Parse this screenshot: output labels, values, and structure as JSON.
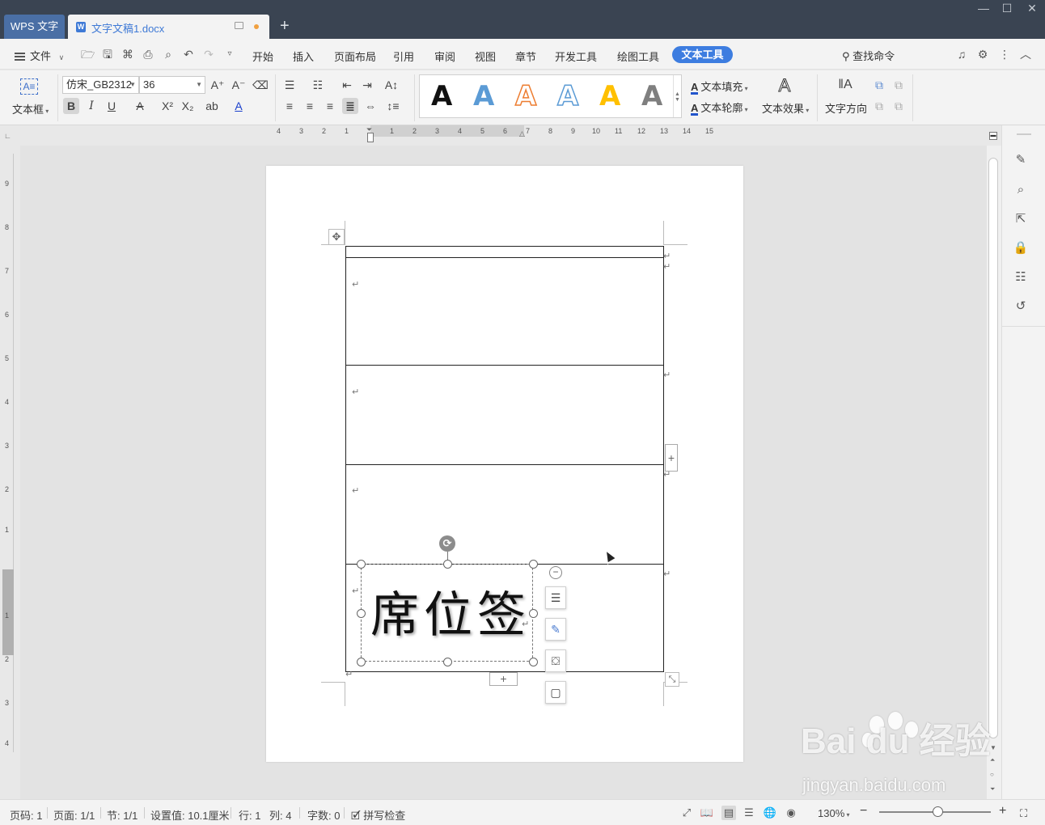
{
  "titlebar": {
    "app_tab": "WPS 文字",
    "doc_tab": "文字文稿1.docx",
    "new_tab": "+"
  },
  "menubar": {
    "file": "文件",
    "items": [
      "开始",
      "插入",
      "页面布局",
      "引用",
      "审阅",
      "视图",
      "章节",
      "开发工具",
      "绘图工具"
    ],
    "active": "文本工具",
    "search": "查找命令"
  },
  "ribbon": {
    "textbox_label": "文本框",
    "font_name": "仿宋_GB2312",
    "font_size": "36",
    "text_fill": "文本填充",
    "text_outline": "文本轮廓",
    "text_effect": "文本效果",
    "text_direction": "文字方向",
    "style_colors": [
      "#111111",
      "#5b9bd5",
      "#ed7d31",
      "#5b9bd5",
      "#ffc000",
      "#7f7f7f"
    ]
  },
  "ruler": {
    "h_numbers": [
      "4",
      "3",
      "2",
      "1",
      "1",
      "2",
      "3",
      "4",
      "5",
      "6",
      "7",
      "8",
      "9",
      "10",
      "11",
      "12",
      "13",
      "14",
      "15"
    ],
    "v_numbers": [
      "9",
      "8",
      "7",
      "6",
      "5",
      "4",
      "3",
      "2",
      "1",
      "1",
      "2",
      "3",
      "4"
    ]
  },
  "document": {
    "textbox_text": "席位签"
  },
  "watermark": {
    "brand": "Bai du 经验",
    "url": "jingyan.baidu.com"
  },
  "statusbar": {
    "page_code": "页码: 1",
    "pages": "页面: 1/1",
    "section": "节: 1/1",
    "setting": "设置值: 10.1厘米",
    "row": "行: 1",
    "col": "列: 4",
    "words": "字数: 0",
    "spell": "拼写检查",
    "zoom": "130%"
  }
}
